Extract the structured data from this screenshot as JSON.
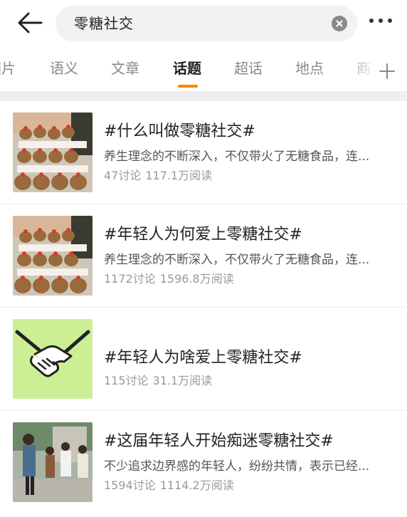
{
  "search": {
    "query": "零糖社交",
    "back_icon": "arrow-left-icon",
    "clear_icon": "close-circle-icon",
    "more_icon": "more-dots-icon"
  },
  "tabs": [
    {
      "label": "图片",
      "active": false
    },
    {
      "label": "语义",
      "active": false
    },
    {
      "label": "文章",
      "active": false
    },
    {
      "label": "话题",
      "active": true
    },
    {
      "label": "超话",
      "active": false
    },
    {
      "label": "地点",
      "active": false
    },
    {
      "label": "商",
      "active": false
    }
  ],
  "accent_color": "#ff8200",
  "topics": [
    {
      "title": "#什么叫做零糖社交#",
      "desc": "养生理念的不断深入，不仅带火了无糖食品，连...",
      "discussions": "47讨论",
      "reads": "117.1万阅读",
      "thumb_icon": "capybara-plush-display-image"
    },
    {
      "title": "#年轻人为何爱上零糖社交#",
      "desc": "养生理念的不断深入，不仅带火了无糖食品，连...",
      "discussions": "1172讨论",
      "reads": "1596.8万阅读",
      "thumb_icon": "capybara-plush-display-image"
    },
    {
      "title": "#年轻人为啥爱上零糖社交#",
      "desc": "",
      "discussions": "115讨论",
      "reads": "31.1万阅读",
      "thumb_icon": "handshake-icon"
    },
    {
      "title": "#这届年轻人开始痴迷零糖社交#",
      "desc": "不少追求边界感的年轻人，纷纷共情，表示已经...",
      "discussions": "1594讨论",
      "reads": "1114.2万阅读",
      "thumb_icon": "people-outdoor-photo"
    }
  ]
}
